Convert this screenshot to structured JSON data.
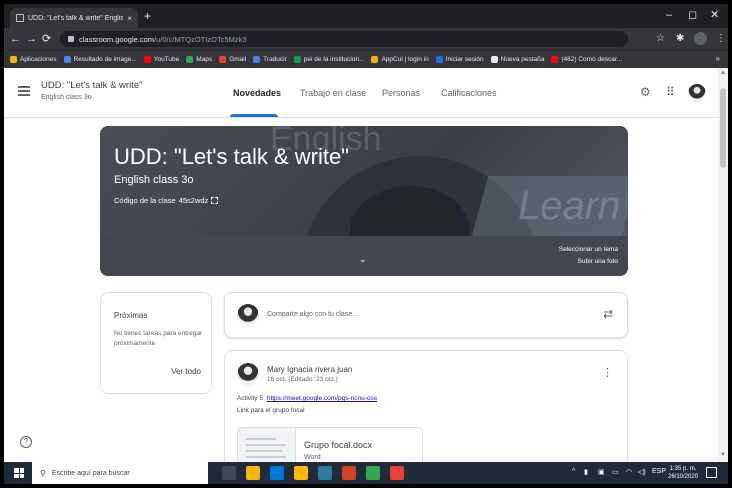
{
  "browser": {
    "tab_title": "UDD: \"Let's talk & write\" English",
    "tab_close": "×",
    "new_tab": "+",
    "window": {
      "minimize": "–",
      "maximize": "◻",
      "close": "✕"
    },
    "nav": {
      "back": "←",
      "forward": "→",
      "reload": "⟳"
    },
    "url_host": "classroom.google.com",
    "url_path": "/u/0/c/MTQzOTIzOTc5Mzk3",
    "bookmarks": [
      {
        "label": "Aplicaciones",
        "color": "#f4b400"
      },
      {
        "label": "Resultado de image...",
        "color": "#4285f4"
      },
      {
        "label": "YouTube",
        "color": "#ff0000"
      },
      {
        "label": "Maps",
        "color": "#34a853"
      },
      {
        "label": "Gmail",
        "color": "#ea4335"
      },
      {
        "label": "Traducir",
        "color": "#4285f4"
      },
      {
        "label": "pei de la institucion...",
        "color": "#0f9d58"
      },
      {
        "label": "AppCul | login in",
        "color": "#f9ab00"
      },
      {
        "label": "Iniciar sesión",
        "color": "#1a73e8"
      },
      {
        "label": "Nueva pestaña",
        "color": "#e8eaed"
      },
      {
        "label": "(462) Como descar...",
        "color": "#ff0000"
      }
    ],
    "bookmarks_more": "»"
  },
  "classroom": {
    "class_name": "UDD: \"Let's talk & write\"",
    "class_section": "English class 3o",
    "tabs": [
      "Novedades",
      "Trabajo en clase",
      "Personas",
      "Calificaciones"
    ],
    "banner": {
      "title": "UDD: \"Let's talk & write\"",
      "subtitle": "English class 3o",
      "code_label": "Código de la clase",
      "code_value": "45s2wdz",
      "select_theme": "Seleccionar un tema",
      "upload_photo": "Subir una foto",
      "watermark_top": "English",
      "watermark_right": "Learn"
    },
    "upcoming": {
      "title": "Próximas",
      "text": "No tienes tareas para entregar próximamente",
      "link": "Ver todo"
    },
    "share_placeholder": "Comparte algo con tu clase...",
    "post": {
      "author": "Mary Ignacia rivera juan",
      "date": "16 oct. (Editado: 23 oct.)",
      "activity_label": "Activity 5",
      "meet_link": "https://meet.google.com/pgs-ncnu-oss",
      "line2": "Link para el grupo focal",
      "attachment_name": "Grupo focal.docx",
      "attachment_type": "Word"
    }
  },
  "taskbar": {
    "search_placeholder": "Escribe aquí para buscar",
    "lang": "ESP",
    "time": "1:35 p. m.",
    "date": "26/10/2020",
    "apps": [
      "#3c4a5c",
      "#f4b400",
      "#0078d7",
      "#ffb900",
      "#2d7d9a",
      "#d04423",
      "#34a853",
      "#ea4335"
    ]
  },
  "accent": "#1a73e8"
}
